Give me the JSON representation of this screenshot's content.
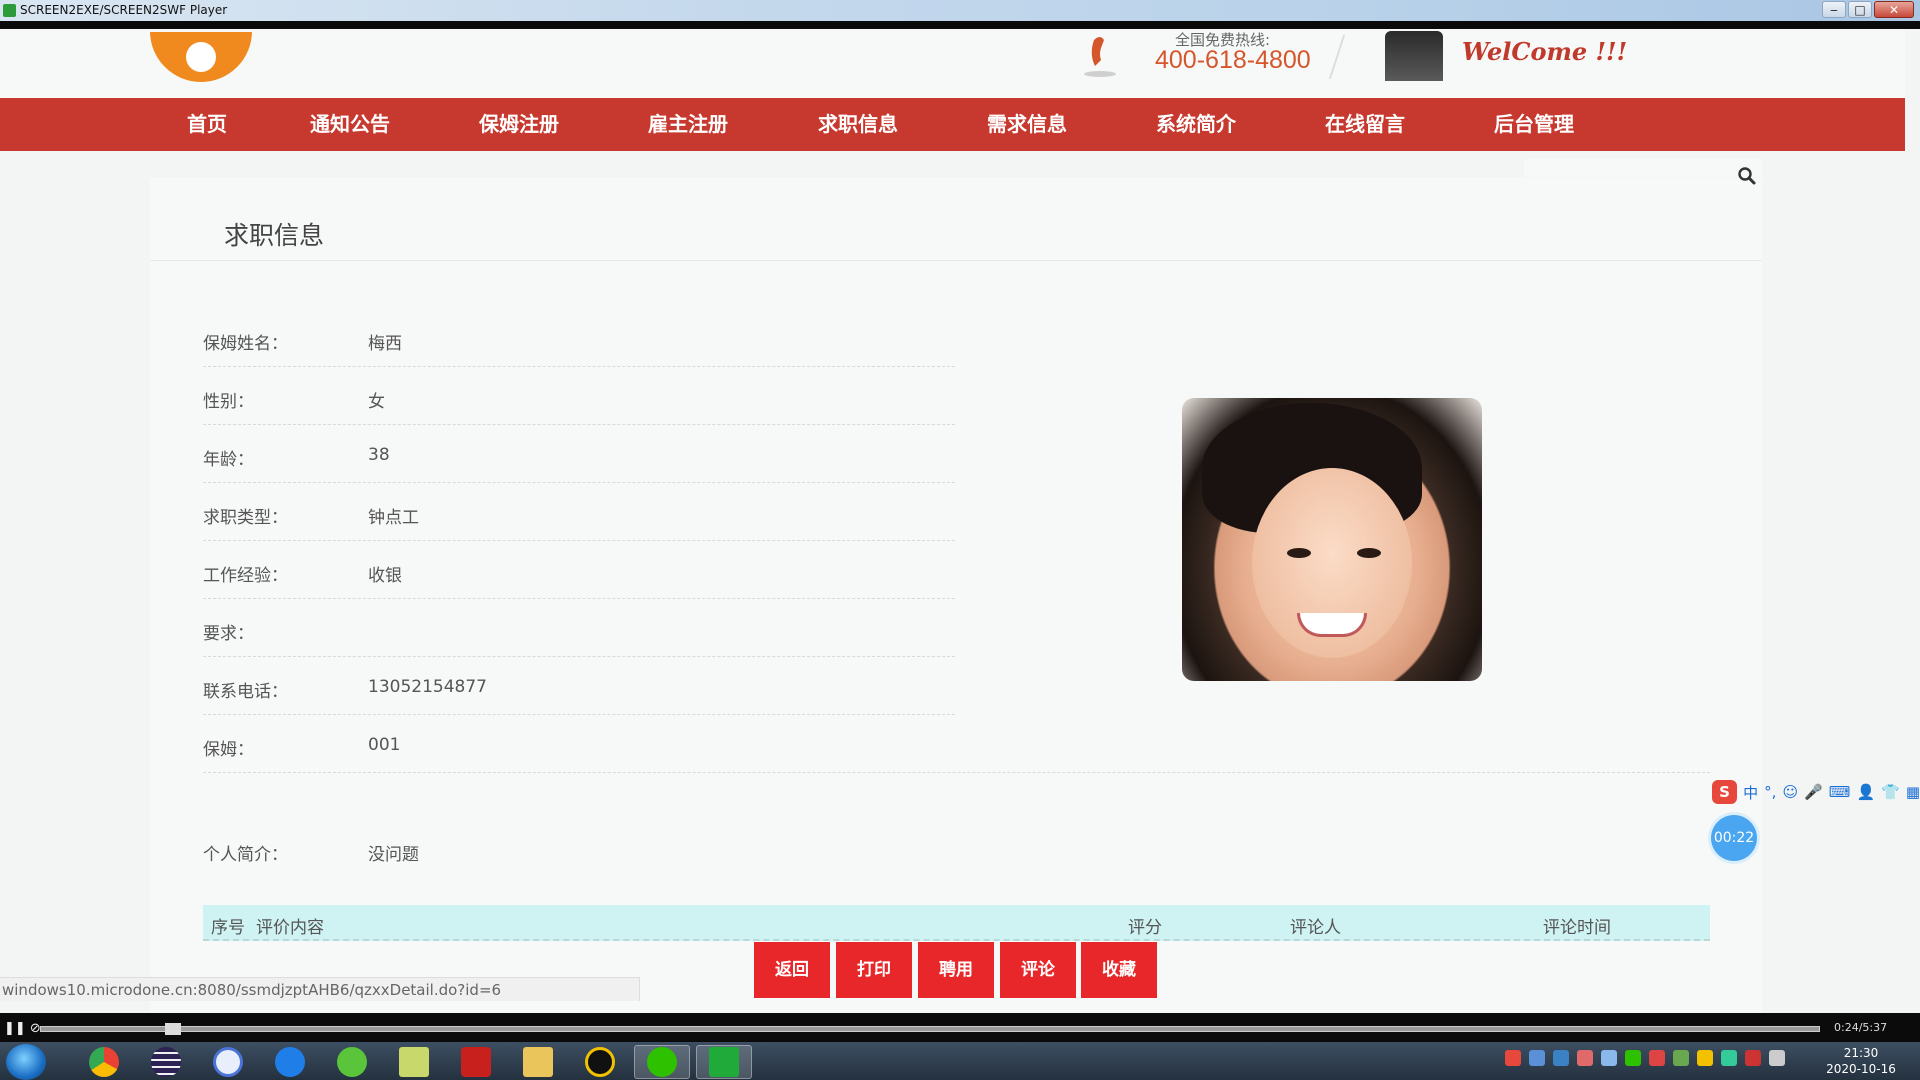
{
  "window": {
    "title": "SCREEN2EXE/SCREEN2SWF Player",
    "controls": {
      "minimize": "‒",
      "maximize": "□",
      "close": "✕"
    }
  },
  "header": {
    "hotline_label": "全国免费热线:",
    "hotline_number": "400-618-4800",
    "welcome": "WelCome !!!"
  },
  "nav": {
    "items": [
      {
        "label": "首页"
      },
      {
        "label": "通知公告"
      },
      {
        "label": "保姆注册"
      },
      {
        "label": "雇主注册"
      },
      {
        "label": "求职信息"
      },
      {
        "label": "需求信息"
      },
      {
        "label": "系统简介"
      },
      {
        "label": "在线留言"
      },
      {
        "label": "后台管理"
      }
    ]
  },
  "page": {
    "heading": "求职信息",
    "fields": [
      {
        "label": "保姆姓名：",
        "value": "梅西"
      },
      {
        "label": "性别：",
        "value": "女"
      },
      {
        "label": "年龄：",
        "value": "38"
      },
      {
        "label": "求职类型：",
        "value": "钟点工"
      },
      {
        "label": "工作经验：",
        "value": "收银"
      },
      {
        "label": "要求：",
        "value": ""
      },
      {
        "label": "联系电话：",
        "value": "13052154877"
      },
      {
        "label": "保姆：",
        "value": "001"
      },
      {
        "label": "个人简介：",
        "value": "没问题"
      }
    ],
    "reviews_table": {
      "columns": [
        "序号",
        "评价内容",
        "评分",
        "评论人",
        "评论时间"
      ]
    },
    "buttons": {
      "back": "返回",
      "print": "打印",
      "hire": "聘用",
      "comment": "评论",
      "favorite": "收藏"
    }
  },
  "status_bar": {
    "url": "windows10.microdone.cn:8080/ssmdjzptAHB6/qzxxDetail.do?id=6"
  },
  "floating": {
    "ime_label": "中",
    "timer": "00:22"
  },
  "player": {
    "time": "0:24/5:37",
    "progress": 0.07
  },
  "taskbar": {
    "clock_time": "21:30",
    "clock_date": "2020-10-16"
  },
  "colors": {
    "nav_bg": "#c7382e",
    "accent_button": "#e8272a",
    "table_header_bg": "#cff2f2",
    "hotline": "#d6562c"
  }
}
